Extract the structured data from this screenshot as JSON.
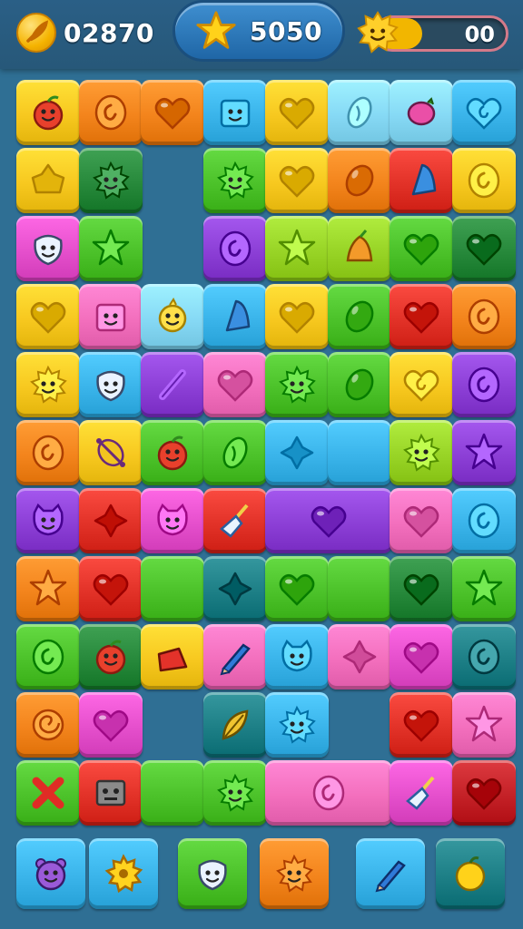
{
  "hud": {
    "coins": "02870",
    "score": "5050",
    "progress_text": "00",
    "progress_fraction": 0.35,
    "coin_icon": "coin-feather-icon",
    "score_icon": "star-icon",
    "sun_icon": "sun-face-icon"
  },
  "colors": {
    "yellow": "#f7c81f",
    "orange": "#f3841c",
    "red": "#e23228",
    "green": "#4cc22a",
    "darkgreen": "#27893b",
    "lime": "#98d426",
    "blue": "#3ab4ea",
    "lightblue": "#86d9f5",
    "purple": "#8c3fd6",
    "magenta": "#e54fcc",
    "pink": "#f36fbd",
    "teal": "#1d7f86",
    "darkred": "#c42127"
  },
  "board": {
    "rows": [
      [
        [
          "yellow",
          "apple"
        ],
        [
          "orange",
          "swirl"
        ],
        [
          "orange",
          "heart",
          false
        ],
        [
          "blue",
          "box-face"
        ],
        [
          "yellow",
          "heart"
        ],
        [
          "lightblue",
          "seed"
        ],
        [
          "lightblue",
          "turtle"
        ],
        [
          "blue",
          "swirl-heart"
        ]
      ],
      [
        [
          "yellow",
          "blob"
        ],
        [
          "darkgreen",
          "sun-face"
        ],
        null,
        [
          "green",
          "sun-face"
        ],
        [
          "yellow",
          "heart"
        ],
        [
          "orange",
          "bean"
        ],
        [
          "red",
          "cone"
        ],
        [
          "yellow",
          "swirl"
        ]
      ],
      [
        [
          "magenta",
          "face"
        ],
        [
          "green",
          "star"
        ],
        null,
        [
          "purple",
          "swirl"
        ],
        [
          "lime",
          "star"
        ],
        [
          "lime",
          "pear"
        ],
        [
          "green",
          "heart"
        ],
        [
          "darkgreen",
          "heart"
        ]
      ],
      [
        [
          "yellow",
          "heart"
        ],
        [
          "pink",
          "box-face"
        ],
        [
          "lightblue",
          "chick"
        ],
        [
          "blue",
          "cone"
        ],
        [
          "yellow",
          "heart"
        ],
        [
          "green",
          "bean"
        ],
        [
          "red",
          "heart"
        ],
        [
          "orange",
          "swirl"
        ]
      ],
      [
        [
          "yellow",
          "sun-face"
        ],
        [
          "blue",
          "face"
        ],
        [
          "purple",
          "slash"
        ],
        [
          "pink",
          "heart"
        ],
        [
          "green",
          "sun-face"
        ],
        [
          "green",
          "bean"
        ],
        [
          "yellow",
          "swirl-heart"
        ],
        [
          "purple",
          "swirl"
        ]
      ],
      [
        [
          "orange",
          "swirl"
        ],
        [
          "yellow",
          "candy"
        ],
        [
          "green",
          "apple"
        ],
        [
          "green",
          "seed"
        ],
        [
          "blue",
          "cross"
        ],
        [
          "blue",
          "",
          false
        ],
        [
          "lime",
          "sun-face"
        ],
        [
          "purple",
          "star"
        ]
      ],
      [
        [
          "purple",
          "cat"
        ],
        [
          "red",
          "cross"
        ],
        [
          "magenta",
          "cat"
        ],
        [
          "red",
          "broom"
        ],
        [
          "purple",
          "heart",
          true
        ],
        null,
        [
          "pink",
          "heart"
        ],
        [
          "blue",
          "swirl"
        ]
      ],
      [
        [
          "orange",
          "star"
        ],
        [
          "red",
          "heart"
        ],
        [
          "green",
          "",
          false
        ],
        [
          "teal",
          "cross"
        ],
        [
          "green",
          "heart"
        ],
        [
          "green",
          "",
          false
        ],
        [
          "darkgreen",
          "heart"
        ],
        [
          "green",
          "star"
        ]
      ],
      [
        [
          "green",
          "swirl"
        ],
        [
          "darkgreen",
          "apple"
        ],
        [
          "yellow",
          "shoe"
        ],
        [
          "pink",
          "pencil"
        ],
        [
          "blue",
          "cat"
        ],
        [
          "pink",
          "cross"
        ],
        [
          "magenta",
          "heart"
        ],
        [
          "teal",
          "swirl"
        ]
      ],
      [
        [
          "orange",
          "spiral"
        ],
        [
          "magenta",
          "heart"
        ],
        null,
        [
          "teal",
          "leaf"
        ],
        [
          "blue",
          "sun-face"
        ],
        null,
        [
          "red",
          "heart"
        ],
        [
          "pink",
          "star"
        ]
      ],
      [
        [
          "green",
          "x"
        ],
        [
          "red",
          "robot"
        ],
        [
          "green",
          "",
          false
        ],
        [
          "green",
          "sun-face"
        ],
        [
          "pink",
          "swirl",
          true
        ],
        null,
        [
          "magenta",
          "broom"
        ],
        [
          "darkred",
          "heart"
        ]
      ]
    ],
    "tray": [
      [
        "blue",
        "bear"
      ],
      [
        "blue",
        "sun"
      ],
      null,
      [
        "green",
        "face"
      ],
      [
        "orange",
        "sun-face"
      ],
      null,
      [
        "blue",
        "pencil"
      ],
      [
        "teal",
        "ball"
      ]
    ]
  }
}
